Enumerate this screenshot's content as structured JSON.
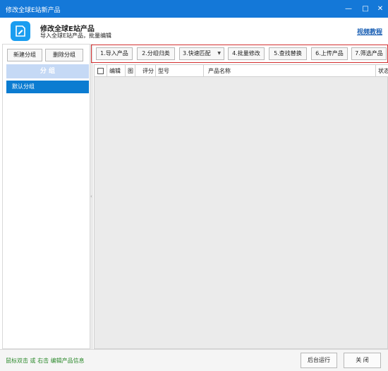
{
  "window": {
    "title": "修改全球E站新产品",
    "controls": {
      "minimize": "—",
      "maximize": "□",
      "close": "✕"
    }
  },
  "header": {
    "title": "修改全球E站产品",
    "subtitle": "导入全球E站产品，批量编辑",
    "video_link": "视频教程",
    "icon": "edit-doc-icon"
  },
  "left_panel": {
    "new_group_label": "新建分组",
    "delete_group_label": "删除分组",
    "group_header": "分 组",
    "groups": [
      {
        "label": "默认分组",
        "selected": true
      }
    ]
  },
  "toolbar": {
    "buttons": [
      {
        "label": "1.导入产品"
      },
      {
        "label": "2.分组归类"
      },
      {
        "label": "3.快速匹配",
        "dropdown": true
      },
      {
        "label": "4.批量修改"
      },
      {
        "label": "5.查找替换"
      },
      {
        "label": "6.上传产品"
      },
      {
        "label": "7.筛选产品"
      }
    ],
    "highlight_color": "#d32f2f"
  },
  "table": {
    "columns": [
      "",
      "编辑",
      "图",
      "评分",
      "型号",
      "产品名称",
      "状态"
    ],
    "rows": []
  },
  "status_bar": {
    "hint": "鼠标双击 或 右击 编辑产品信息",
    "run_background_label": "后台运行",
    "close_label": "关 闭"
  },
  "colors": {
    "titlebar": "#1478d8",
    "selected_group": "#0b7cd1",
    "group_header": "#c5d9f5",
    "hint_text": "#2e8b2e",
    "link": "#1a5fb4"
  }
}
